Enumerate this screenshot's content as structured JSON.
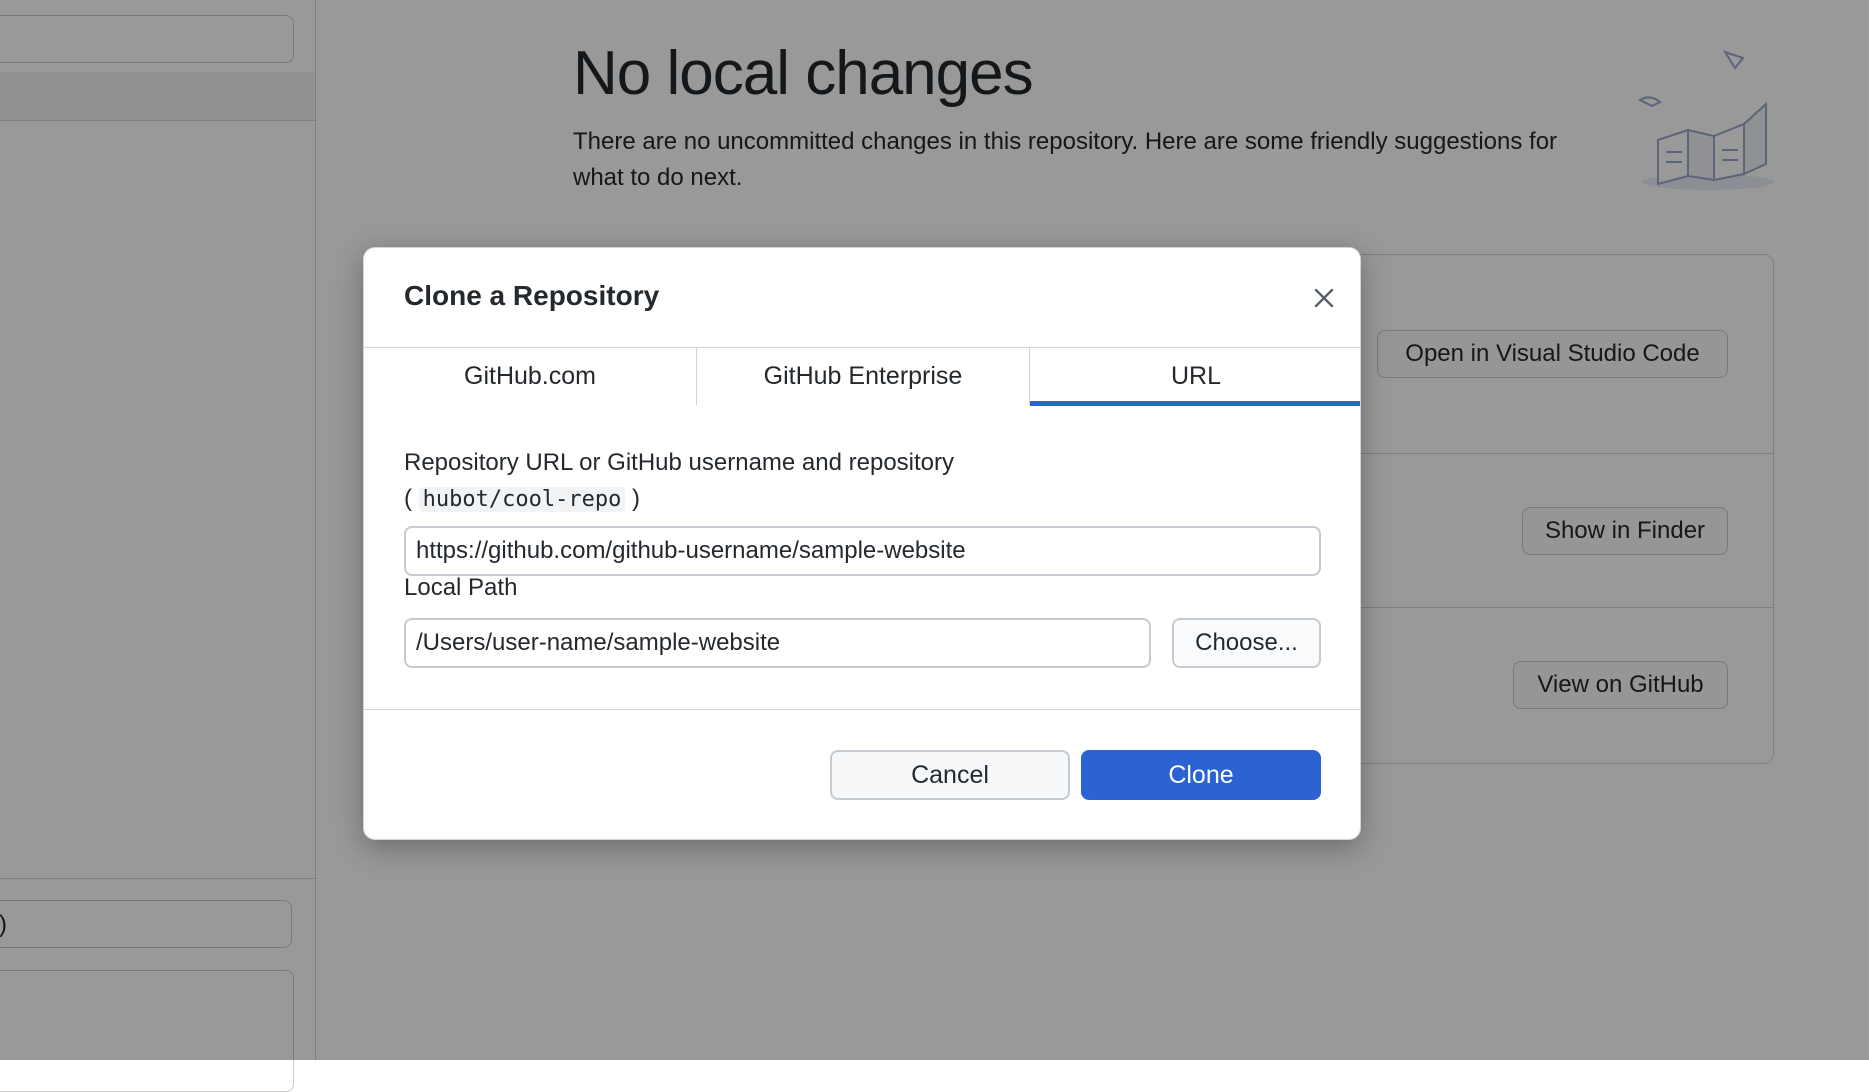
{
  "background": {
    "sidebar": {
      "summary_partial": ")"
    },
    "main": {
      "title": "No local changes",
      "subtitle": "There are no uncommitted changes in this repository. Here are some friendly suggestions for what to do next."
    },
    "suggestions": [
      {
        "button_label": "Open in Visual Studio Code"
      },
      {
        "button_label": "Show in Finder"
      },
      {
        "button_label": "View on GitHub"
      }
    ]
  },
  "dialog": {
    "title": "Clone a Repository",
    "tabs": [
      {
        "label": "GitHub.com",
        "selected": false
      },
      {
        "label": "GitHub Enterprise",
        "selected": false
      },
      {
        "label": "URL",
        "selected": true
      }
    ],
    "url_field": {
      "label": "Repository URL or GitHub username and repository",
      "hint_open": "(",
      "hint_code": "hubot/cool-repo",
      "hint_close": ")",
      "value": "https://github.com/github-username/sample-website"
    },
    "path_field": {
      "label": "Local Path",
      "value": "/Users/user-name/sample-website",
      "choose_label": "Choose..."
    },
    "cancel_label": "Cancel",
    "clone_label": "Clone"
  },
  "colors": {
    "accent": "#2b63d3",
    "overlay": "rgba(0,0,0,0.40)"
  }
}
